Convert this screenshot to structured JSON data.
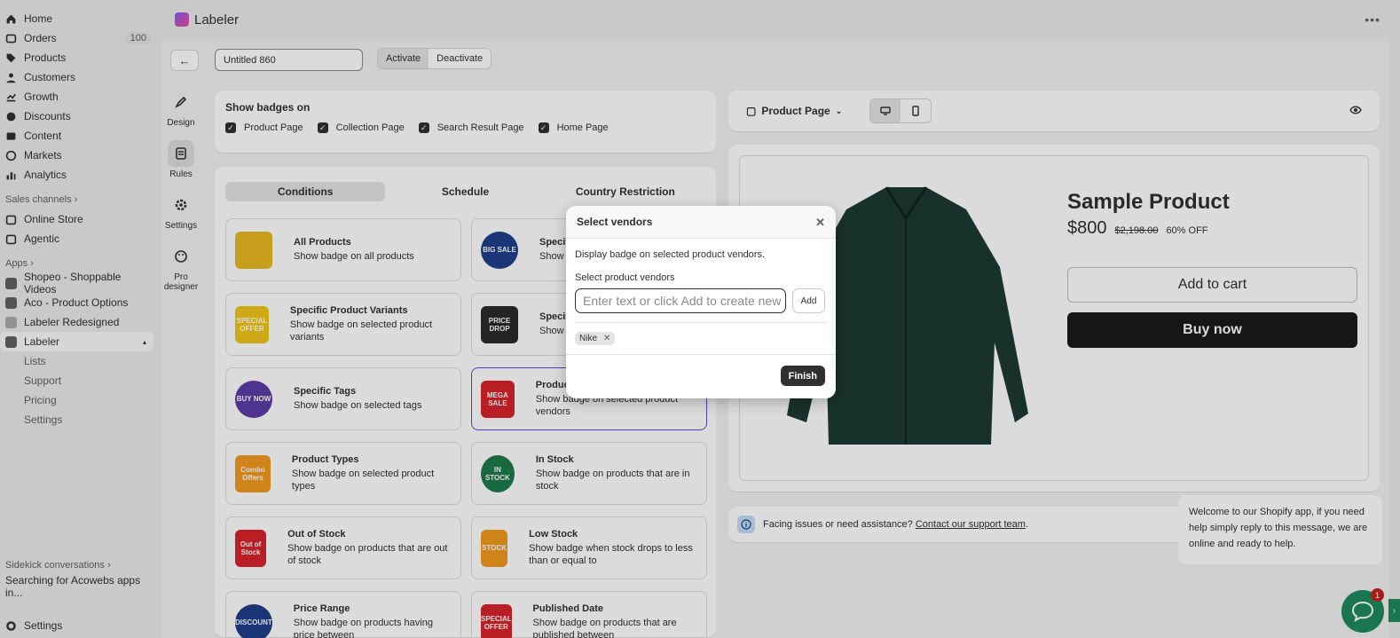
{
  "sidebar": {
    "items": [
      {
        "label": "Home",
        "icon": "home-icon"
      },
      {
        "label": "Orders",
        "icon": "orders-icon",
        "count": "100"
      },
      {
        "label": "Products",
        "icon": "tag-icon"
      },
      {
        "label": "Customers",
        "icon": "person-icon"
      },
      {
        "label": "Growth",
        "icon": "growth-icon"
      },
      {
        "label": "Discounts",
        "icon": "discount-icon"
      },
      {
        "label": "Content",
        "icon": "content-icon"
      },
      {
        "label": "Markets",
        "icon": "globe-icon"
      },
      {
        "label": "Analytics",
        "icon": "chart-icon"
      }
    ],
    "sales_channels_label": "Sales channels",
    "sales_channels": [
      {
        "label": "Online Store"
      },
      {
        "label": "Agentic"
      }
    ],
    "apps_label": "Apps",
    "apps": [
      {
        "label": "Shopeo - Shoppable Videos"
      },
      {
        "label": "Aco - Product Options"
      },
      {
        "label": "Labeler Redesigned"
      },
      {
        "label": "Labeler"
      }
    ],
    "labeler_sub": [
      "Lists",
      "Support",
      "Pricing",
      "Settings"
    ],
    "sidekick_label": "Sidekick conversations",
    "sidekick_item": "Searching for Acowebs apps in...",
    "settings_label": "Settings"
  },
  "topbar": {
    "title": "Labeler"
  },
  "toolbar": {
    "title_value": "Untitled 860",
    "activate_label": "Activate",
    "deactivate_label": "Deactivate"
  },
  "tools": [
    {
      "label": "Design",
      "icon": "brush-icon"
    },
    {
      "label": "Rules",
      "icon": "scroll-icon"
    },
    {
      "label": "Settings",
      "icon": "gear-icon"
    },
    {
      "label": "Pro designer",
      "icon": "palette-icon"
    }
  ],
  "show_badges": {
    "title": "Show badges on",
    "options": [
      "Product Page",
      "Collection Page",
      "Search Result Page",
      "Home Page"
    ]
  },
  "conditions": {
    "tabs": [
      "Conditions",
      "Schedule",
      "Country Restriction"
    ],
    "options": [
      {
        "title": "All Products",
        "desc": "Show badge on all products",
        "color": "#e8b820",
        "badge": ""
      },
      {
        "title": "Specific Products",
        "desc": "Show badge on selected products",
        "color": "#1f3f8a",
        "badge": "BIG SALE"
      },
      {
        "title": "Specific Product Variants",
        "desc": "Show badge on selected product variants",
        "color": "#f0c419",
        "badge": "SPECIAL OFFER"
      },
      {
        "title": "Specific Collections",
        "desc": "Show badge on selected collections",
        "color": "#2a2a2a",
        "badge": "PRICE DROP"
      },
      {
        "title": "Specific Tags",
        "desc": "Show badge on selected tags",
        "color": "#5b3da6",
        "badge": "BUY NOW"
      },
      {
        "title": "Product Vendors",
        "desc": "Show badge on selected product vendors",
        "color": "#d8232a",
        "badge": "MEGA SALE"
      },
      {
        "title": "Product Types",
        "desc": "Show badge on selected product types",
        "color": "#f29a1f",
        "badge": "Combo Offers"
      },
      {
        "title": "In Stock",
        "desc": "Show badge on products that are in stock",
        "color": "#1e7a4a",
        "badge": "IN STOCK"
      },
      {
        "title": "Out of Stock",
        "desc": "Show badge on products that are out of stock",
        "color": "#d8232a",
        "badge": "Out of Stock"
      },
      {
        "title": "Low Stock",
        "desc": "Show badge when stock drops to less than or equal to",
        "color": "#f29a1f",
        "badge": "STOCK"
      },
      {
        "title": "Price Range",
        "desc": "Show badge on products having price between",
        "color": "#1f3f8a",
        "badge": "DISCOUNT"
      },
      {
        "title": "Published Date",
        "desc": "Show badge on products that are published between",
        "color": "#d8232a",
        "badge": "SPECIAL OFFER"
      }
    ]
  },
  "preview": {
    "page_select": "Product Page",
    "product_title": "Sample Product",
    "price": "$800",
    "old_price": "$2,198.00",
    "discount": "60% OFF",
    "add_to_cart": "Add to cart",
    "buy_now": "Buy now"
  },
  "help": {
    "text": "Facing issues or need assistance?",
    "link": "Contact our support team",
    "suffix": "."
  },
  "modal": {
    "title": "Select vendors",
    "description": "Display badge on selected product vendors.",
    "field_label": "Select product vendors",
    "input_placeholder": "Enter text or click Add to create new",
    "add_label": "Add",
    "tags": [
      "Nike"
    ],
    "finish_label": "Finish"
  },
  "chat": {
    "message": "Welcome to our Shopify app, if you need help simply reply to this message, we are online and ready to help.",
    "unread": "1"
  },
  "colors": {
    "accent": "#5b4cdb",
    "primary_button": "#303030",
    "shirt": "#1c3a33",
    "chat": "#1e8a5e"
  }
}
